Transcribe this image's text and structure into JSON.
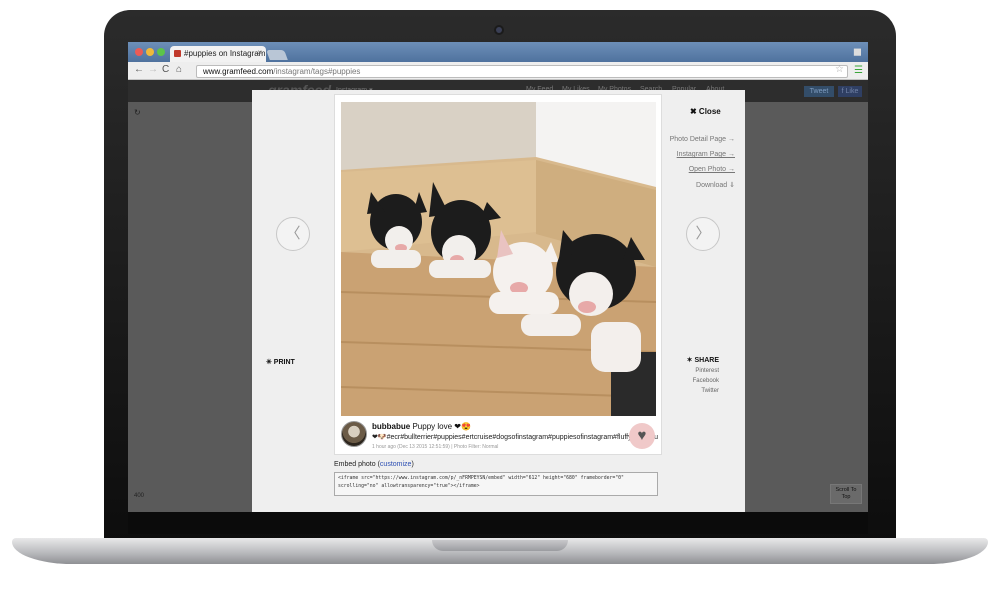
{
  "browser": {
    "tab_title": "#puppies on Instagram",
    "url_host": "www.gramfeed.com",
    "url_path": "/instagram/tags#puppies"
  },
  "site": {
    "logo": "gramfeed",
    "nav": [
      "Instagram ▾",
      "My Feed",
      "My Likes",
      "My Photos",
      "Search",
      "Popular",
      "About"
    ],
    "tweet": "Tweet",
    "like": "f Like",
    "photo_count": "400",
    "scroll_top_line1": "Scroll To",
    "scroll_top_line2": "Top"
  },
  "modal": {
    "close": "✖ Close",
    "print": "✳ PRINT",
    "prev": "〈",
    "next": "〉",
    "links": [
      "Photo Detail Page →",
      "Instagram Page →",
      "Open Photo →",
      "Download ⇓"
    ],
    "share_title": "✶ SHARE",
    "share_links": [
      "Pinterest",
      "Facebook",
      "Twitter"
    ],
    "username": "bubbabue",
    "caption": "Puppy love ❤😍",
    "hashtags": "❤🐶#ecr#bullterrier#puppies#ertcruise#dogsofinstagram#puppiesofinstagram#fluffydogs#cup",
    "meta": "1 hour ago (Dec 13 2015 12:51:59) | Photo Filter: Normal",
    "embed_label_prefix": "Embed photo (",
    "embed_link": "customize",
    "embed_label_suffix": ")",
    "embed_code": "<iframe src=\"https://www.instagram.com/p/_nFRMPEYSN/embed\" width=\"612\" height=\"680\" frameborder=\"0\" scrolling=\"no\" allowtransparency=\"true\"></iframe>"
  },
  "icons": {
    "heart": "♥",
    "refresh": "↻"
  }
}
